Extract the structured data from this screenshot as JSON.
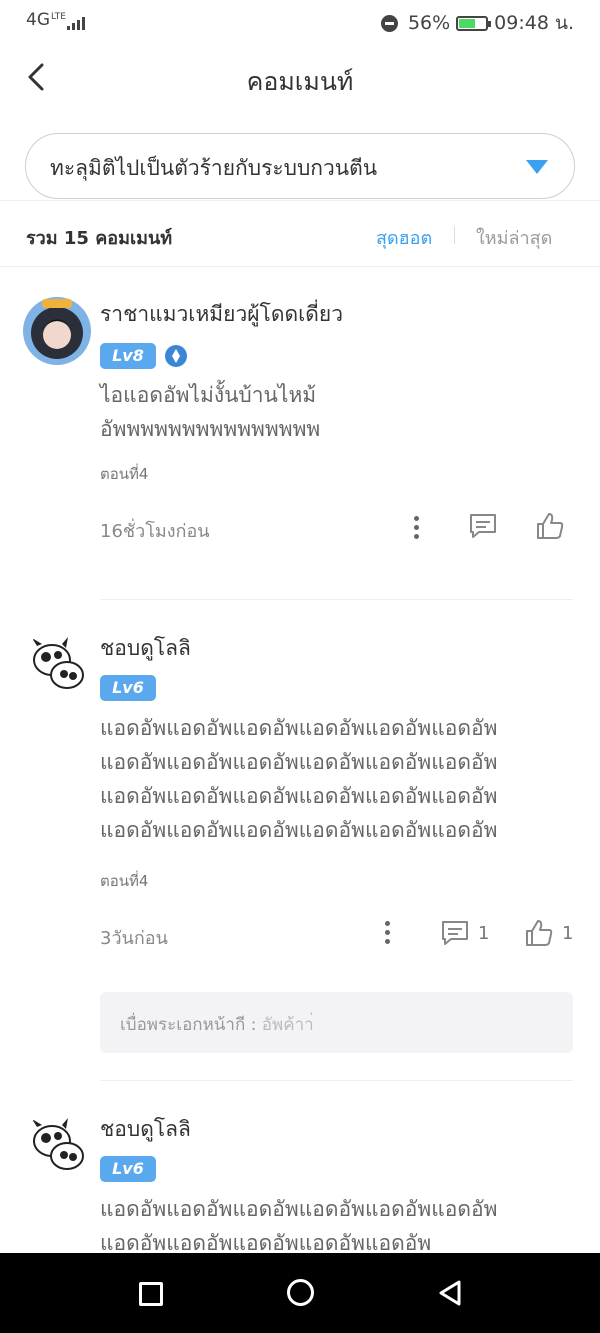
{
  "status": {
    "network": "4G",
    "lte": "LTE",
    "battery": "56%",
    "time": "09:48 น."
  },
  "header": {
    "title": "คอมเมนท์"
  },
  "selector": {
    "value": "ทะลุมิติไปเป็นตัวร้ายกับระบบกวนตีน"
  },
  "summary": {
    "count_label": "รวม 15 คอมเมนท์",
    "sort_hot": "สุดฮอต",
    "sort_new": "ใหม่ล่าสุด"
  },
  "comments": [
    {
      "name": "ราชาแมวเหมียวผู้โดดเดี่ยว",
      "level": "Lv8",
      "text": "ไอแอดอัพไม่งั้นบ้านไหม้\nอัพพพพพพพพพพพพพพพ",
      "episode": "ตอนที่4",
      "time": "16ชั่วโมงก่อน",
      "reply_count": "",
      "like_count": ""
    },
    {
      "name": "ชอบดูโลลิ",
      "level": "Lv6",
      "text": "แอดอัพแอดอัพแอดอัพแอดอัพแอดอัพแอดอัพ\nแอดอัพแอดอัพแอดอัพแอดอัพแอดอัพแอดอัพ\nแอดอัพแอดอัพแอดอัพแอดอัพแอดอัพแอดอัพ\nแอดอัพแอดอัพแอดอัพแอดอัพแอดอัพแอดอัพ",
      "episode": "ตอนที่4",
      "time": "3วันก่อน",
      "reply_count": "1",
      "like_count": "1",
      "reply": {
        "author": "เบื่อพระเอกหน้ากี :",
        "text": "อัพค้าา่"
      }
    },
    {
      "name": "ชอบดูโลลิ",
      "level": "Lv6",
      "text": "แอดอัพแอดอัพแอดอัพแอดอัพแอดอัพแอดอัพ\nแอดอัพแอดอัพแอดอัพแอดอัพแอดอัพ"
    }
  ],
  "colors": {
    "accent": "#3aa0ef",
    "level_badge": "#5aa9ef"
  }
}
